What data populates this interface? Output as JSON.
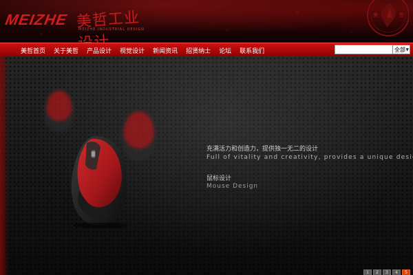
{
  "brand": {
    "logo_en": "MEIZHE",
    "logo_cn": "美哲工业设计",
    "logo_sub": "MEIZHE INDUSTRIAL DESIGN",
    "seal_text": "美哲"
  },
  "nav": {
    "items": [
      {
        "label": "美哲首页"
      },
      {
        "label": "关于美哲"
      },
      {
        "label": "产品设计"
      },
      {
        "label": "视觉设计"
      },
      {
        "label": "新闻资讯"
      },
      {
        "label": "招贤纳士"
      },
      {
        "label": "论坛"
      },
      {
        "label": "联系我们"
      }
    ]
  },
  "search": {
    "value": "",
    "select_value": "全部"
  },
  "banner": {
    "tagline_cn": "充满活力和创造力，提供独一无二的设计",
    "tagline_en": "Full of vitality and creativity, provides a unique design",
    "category_cn": "鼠标设计",
    "category_en": "Mouse Design"
  },
  "pager": {
    "pages": [
      "1",
      "2",
      "3",
      "4",
      "5"
    ],
    "active": "5"
  },
  "colors": {
    "accent_red": "#d01010",
    "mouse_red": "#b3191b",
    "active_page": "#d24a10"
  }
}
